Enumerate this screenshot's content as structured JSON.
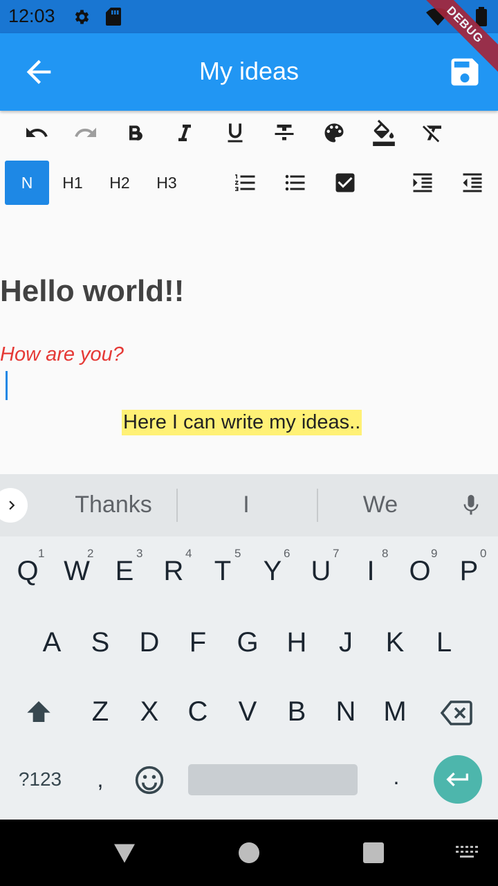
{
  "status_bar": {
    "time": "12:03",
    "debug_label": "DEBUG"
  },
  "app_bar": {
    "title": "My ideas",
    "back_icon": "arrow-back-icon",
    "save_icon": "save-icon"
  },
  "toolbar": {
    "row1": [
      "undo-icon",
      "redo-icon",
      "bold-icon",
      "italic-icon",
      "underline-icon",
      "strikethrough-icon",
      "text-color-icon",
      "background-color-icon",
      "clear-format-icon"
    ],
    "headings": {
      "normal": "N",
      "h1": "H1",
      "h2": "H2",
      "h3": "H3"
    },
    "row2_icons": [
      "numbered-list-icon",
      "bullet-list-icon",
      "checkbox-icon",
      "indent-increase-icon",
      "indent-decrease-icon"
    ]
  },
  "editor": {
    "heading": "Hello world!!",
    "italic_line": "How are you?",
    "highlight_line": "Here I can write my ideas..",
    "colors": {
      "heading": "#424242",
      "italic": "#e53935",
      "highlight_bg": "#fff176"
    }
  },
  "keyboard": {
    "suggestions": [
      "Thanks",
      "I",
      "We"
    ],
    "row1": [
      "Q",
      "W",
      "E",
      "R",
      "T",
      "Y",
      "U",
      "I",
      "O",
      "P"
    ],
    "row1_hints": [
      "1",
      "2",
      "3",
      "4",
      "5",
      "6",
      "7",
      "8",
      "9",
      "0"
    ],
    "row2": [
      "A",
      "S",
      "D",
      "F",
      "G",
      "H",
      "J",
      "K",
      "L"
    ],
    "row3": [
      "Z",
      "X",
      "C",
      "V",
      "B",
      "N",
      "M"
    ],
    "symbols_key": "?123",
    "comma_key": ",",
    "period_key": "."
  },
  "colors": {
    "primary": "#2196f3",
    "status_bar": "#1976d2",
    "accent": "#1e88e5",
    "enter_key": "#4db6ac"
  }
}
